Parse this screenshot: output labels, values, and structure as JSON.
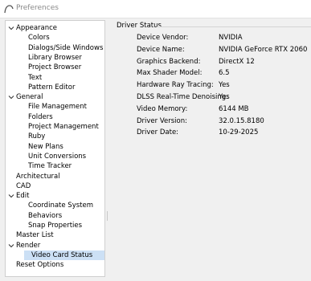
{
  "window": {
    "title": "Preferences"
  },
  "tree": {
    "items": [
      {
        "label": "Appearance",
        "level": 0,
        "expanded": true
      },
      {
        "label": "Colors",
        "level": 1
      },
      {
        "label": "Dialogs/Side Windows",
        "level": 1
      },
      {
        "label": "Library Browser",
        "level": 1
      },
      {
        "label": "Project Browser",
        "level": 1
      },
      {
        "label": "Text",
        "level": 1
      },
      {
        "label": "Pattern Editor",
        "level": 1
      },
      {
        "label": "General",
        "level": 0,
        "expanded": true
      },
      {
        "label": "File Management",
        "level": 1
      },
      {
        "label": "Folders",
        "level": 1
      },
      {
        "label": "Project Management",
        "level": 1
      },
      {
        "label": "Ruby",
        "level": 1
      },
      {
        "label": "New Plans",
        "level": 1
      },
      {
        "label": "Unit Conversions",
        "level": 1
      },
      {
        "label": "Time Tracker",
        "level": 1
      },
      {
        "label": "Architectural",
        "level": 0
      },
      {
        "label": "CAD",
        "level": 0
      },
      {
        "label": "Edit",
        "level": 0,
        "expanded": true
      },
      {
        "label": "Coordinate System",
        "level": 1
      },
      {
        "label": "Behaviors",
        "level": 1
      },
      {
        "label": "Snap Properties",
        "level": 1
      },
      {
        "label": "Master List",
        "level": 0
      },
      {
        "label": "Render",
        "level": 0,
        "expanded": true
      },
      {
        "label": "Video Card Status",
        "level": 1,
        "selected": true
      },
      {
        "label": "Reset Options",
        "level": 0
      }
    ]
  },
  "driver_status": {
    "group_title": "Driver Status",
    "rows": [
      {
        "label": "Device Vendor:",
        "value": "NVIDIA"
      },
      {
        "label": "Device Name:",
        "value": "NVIDIA GeForce RTX 2060"
      },
      {
        "label": "Graphics Backend:",
        "value": "DirectX 12"
      },
      {
        "label": "Max Shader Model:",
        "value": "6.5"
      },
      {
        "label": "Hardware Ray Tracing:",
        "value": "Yes"
      },
      {
        "label": "DLSS Real-Time Denoising:",
        "value": "Yes"
      },
      {
        "label": "Video Memory:",
        "value": "6144 MB"
      },
      {
        "label": "Driver Version:",
        "value": "32.0.15.8180"
      },
      {
        "label": "Driver Date:",
        "value": "10-29-2025"
      }
    ]
  },
  "colors": {
    "selection": "#cce0f5",
    "title_text": "#8a8a8a",
    "window_bg": "#f0f0f0"
  }
}
